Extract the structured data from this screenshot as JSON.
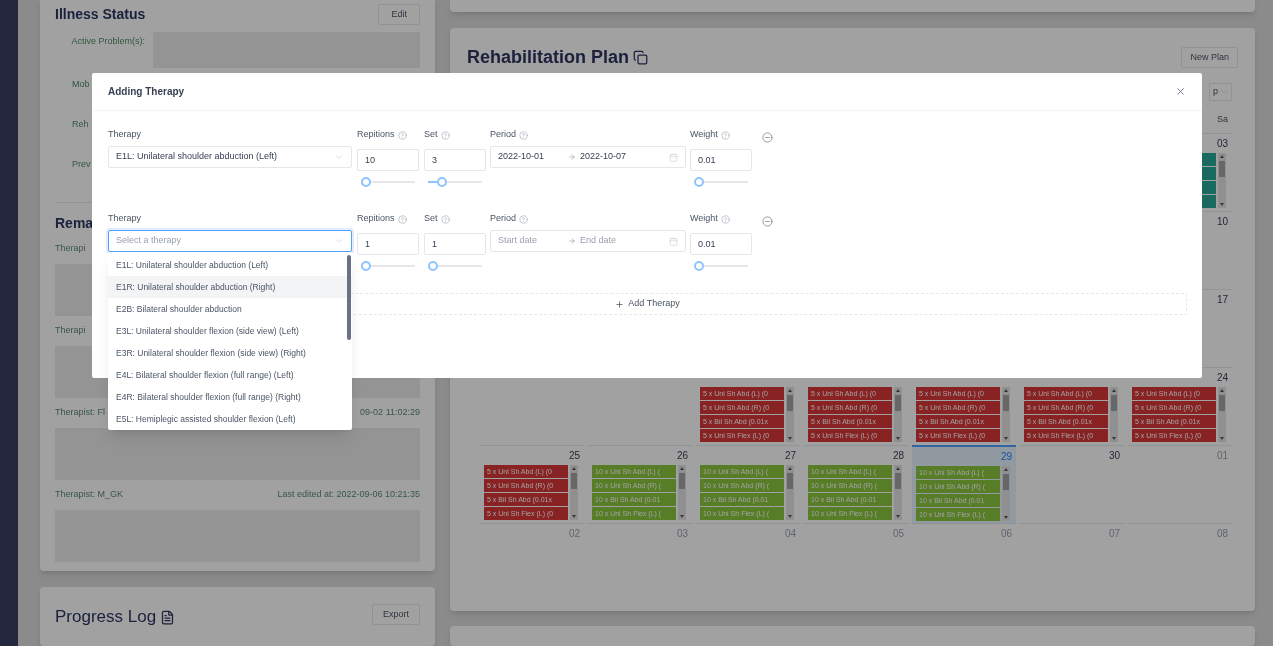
{
  "left_panel": {
    "illness_status": {
      "title": "Illness Status",
      "edit_button": "Edit",
      "active_problems_label": "Active Problem(s):",
      "partial_labels": [
        "Mob",
        "Reh",
        "Prev"
      ]
    },
    "remarks": {
      "title": "Rema",
      "entries": [
        {
          "therapist": "Therapi"
        },
        {
          "therapist": "Therapi"
        },
        {
          "therapist": "Therapist: Fl",
          "edited": "09-02 11:02:29"
        },
        {
          "therapist": "Therapist: M_GK",
          "edited": "Last edited at: 2022-09-06 10:21:35"
        }
      ]
    },
    "progress_log": {
      "title": "Progress Log",
      "export_button": "Export"
    }
  },
  "rehabilitation_plan": {
    "title": "Rehabilitation Plan",
    "new_plan_button": "New Plan",
    "view_select": "p",
    "saturday_header": "Sa",
    "weeks": [
      {
        "days": [
          {
            "number": "03",
            "muted": false,
            "selected": false,
            "events": [
              {
                "kind": "planned"
              },
              {
                "kind": "planned"
              },
              {
                "kind": "planned"
              },
              {
                "kind": "planned"
              }
            ]
          }
        ]
      },
      {
        "days": [
          {
            "number": "10",
            "muted": false,
            "selected": false
          }
        ]
      },
      {
        "days": [
          {
            "number": "17",
            "muted": false,
            "selected": false
          }
        ]
      },
      {
        "days": [
          {
            "events": [
              {
                "text": "5 x Uni Sh Abd (L) (0",
                "kind": "missed"
              },
              {
                "text": "5 x Uni Sh Abd (R) (0",
                "kind": "missed"
              },
              {
                "text": "5 x Bil Sh Abd (0.01x",
                "kind": "missed"
              },
              {
                "text": "5 x Uni Sh Flex (L) (0",
                "kind": "missed"
              }
            ]
          },
          {
            "events": [
              {
                "text": "5 x Uni Sh Abd (L) (0",
                "kind": "missed"
              },
              {
                "text": "5 x Uni Sh Abd (R) (0",
                "kind": "missed"
              },
              {
                "text": "5 x Bil Sh Abd (0.01x",
                "kind": "missed"
              },
              {
                "text": "5 x Uni Sh Flex (L) (0",
                "kind": "missed"
              }
            ]
          },
          {
            "events": [
              {
                "text": "5 x Uni Sh Abd (L) (0",
                "kind": "missed"
              },
              {
                "text": "5 x Uni Sh Abd (R) (0",
                "kind": "missed"
              },
              {
                "text": "5 x Bil Sh Abd (0.01x",
                "kind": "missed"
              },
              {
                "text": "5 x Uni Sh Flex (L) (0",
                "kind": "missed"
              }
            ]
          },
          {
            "events": [
              {
                "text": "5 x Uni Sh Abd (L) (0",
                "kind": "missed"
              },
              {
                "text": "5 x Uni Sh Abd (R) (0",
                "kind": "missed"
              },
              {
                "text": "5 x Bil Sh Abd (0.01x",
                "kind": "missed"
              },
              {
                "text": "5 x Uni Sh Flex (L) (0",
                "kind": "missed"
              }
            ]
          },
          {
            "number": "24",
            "muted": false,
            "selected": false,
            "events": [
              {
                "text": "5 x Uni Sh Abd (L) (0",
                "kind": "missed"
              },
              {
                "text": "5 x Uni Sh Abd (R) (0",
                "kind": "missed"
              },
              {
                "text": "5 x Bil Sh Abd (0.01x",
                "kind": "missed"
              },
              {
                "text": "5 x Uni Sh Flex (L) (0",
                "kind": "missed"
              }
            ]
          }
        ]
      },
      {
        "days": [
          {
            "number": "25",
            "muted": false,
            "selected": false,
            "events": [
              {
                "text": "5 x Uni Sh Abd (L) (0",
                "kind": "missed"
              },
              {
                "text": "5 x Uni Sh Abd (R) (0",
                "kind": "missed"
              },
              {
                "text": "5 x Bil Sh Abd (0.01x",
                "kind": "missed"
              },
              {
                "text": "5 x Uni Sh Flex (L) (0",
                "kind": "missed"
              }
            ]
          },
          {
            "number": "26",
            "muted": false,
            "selected": false,
            "events": [
              {
                "text": "10 x Uni Sh Abd (L) (",
                "kind": "done"
              },
              {
                "text": "10 x Uni Sh Abd (R) (",
                "kind": "done"
              },
              {
                "text": "10 x Bil Sh Abd (0.01",
                "kind": "done"
              },
              {
                "text": "10 x Uni Sh Flex (L) (",
                "kind": "done"
              }
            ]
          },
          {
            "number": "27",
            "muted": false,
            "selected": false,
            "events": [
              {
                "text": "10 x Uni Sh Abd (L) (",
                "kind": "done"
              },
              {
                "text": "10 x Uni Sh Abd (R) (",
                "kind": "done"
              },
              {
                "text": "10 x Bil Sh Abd (0.01",
                "kind": "done"
              },
              {
                "text": "10 x Uni Sh Flex (L) (",
                "kind": "done"
              }
            ]
          },
          {
            "number": "28",
            "muted": false,
            "selected": false,
            "events": [
              {
                "text": "10 x Uni Sh Abd (L) (",
                "kind": "done"
              },
              {
                "text": "10 x Uni Sh Abd (R) (",
                "kind": "done"
              },
              {
                "text": "10 x Bil Sh Abd (0.01",
                "kind": "done"
              },
              {
                "text": "10 x Uni Sh Flex (L) (",
                "kind": "done"
              }
            ]
          },
          {
            "number": "29",
            "muted": false,
            "selected": true,
            "events": [
              {
                "text": "10 x Uni Sh Abd (L) (",
                "kind": "done"
              },
              {
                "text": "10 x Uni Sh Abd (R) (",
                "kind": "done"
              },
              {
                "text": "10 x Bil Sh Abd (0.01",
                "kind": "done"
              },
              {
                "text": "10 x Uni Sh Flex (L) (",
                "kind": "done"
              }
            ]
          },
          {
            "number": "30",
            "muted": false,
            "selected": false
          },
          {
            "number": "01",
            "muted": true,
            "selected": false
          }
        ]
      },
      {
        "days": [
          {
            "number": "02",
            "muted": true,
            "selected": false
          },
          {
            "number": "03",
            "muted": true,
            "selected": false
          },
          {
            "number": "04",
            "muted": true,
            "selected": false
          },
          {
            "number": "05",
            "muted": true,
            "selected": false
          },
          {
            "number": "06",
            "muted": true,
            "selected": false
          },
          {
            "number": "07",
            "muted": true,
            "selected": false
          },
          {
            "number": "08",
            "muted": true,
            "selected": false
          }
        ]
      }
    ]
  },
  "modal": {
    "title": "Adding Therapy",
    "therapies": [
      {
        "therapy_label": "Therapy",
        "therapy_value": "E1L: Unilateral shoulder abduction (Left)",
        "focused": false,
        "repetitions_label": "Repitions",
        "repetitions": {
          "value": "10",
          "level": 0
        },
        "set_label": "Set",
        "set": {
          "value": "3",
          "level": 0.2
        },
        "period_label": "Period",
        "period_start": "2022-10-01",
        "period_end": "2022-10-07",
        "weight_label": "Weight",
        "weight": {
          "value": "0.01",
          "level": 0
        }
      },
      {
        "therapy_label": "Therapy",
        "therapy_placeholder": "Select a therapy",
        "focused": true,
        "repetitions_label": "Repitions",
        "repetitions": {
          "value": "1",
          "level": 0
        },
        "set_label": "Set",
        "set": {
          "value": "1",
          "level": 0
        },
        "period_label": "Period",
        "period_start_placeholder": "Start date",
        "period_end_placeholder": "End date",
        "weight_label": "Weight",
        "weight": {
          "value": "0.01",
          "level": 0
        }
      }
    ],
    "add_button": "Add Therapy",
    "dropdown": {
      "options": [
        {
          "label": "E1L: Unilateral shoulder abduction (Left)",
          "highlighted": false
        },
        {
          "label": "E1R: Unilateral shoulder abduction (Right)",
          "highlighted": true
        },
        {
          "label": "E2B: Bilateral shoulder abduction",
          "highlighted": false
        },
        {
          "label": "E3L: Unilateral shoulder flexion (side view) (Left)",
          "highlighted": false
        },
        {
          "label": "E3R: Unilateral shoulder flexion (side view) (Right)",
          "highlighted": false
        },
        {
          "label": "E4L: Bilateral shoulder flexion (full range) (Left)",
          "highlighted": false
        },
        {
          "label": "E4R: Bilateral shoulder flexion (full range) (Right)",
          "highlighted": false
        },
        {
          "label": "E5L: Hemiplegic assisted shoulder flexion (Left)",
          "highlighted": false
        }
      ]
    }
  }
}
